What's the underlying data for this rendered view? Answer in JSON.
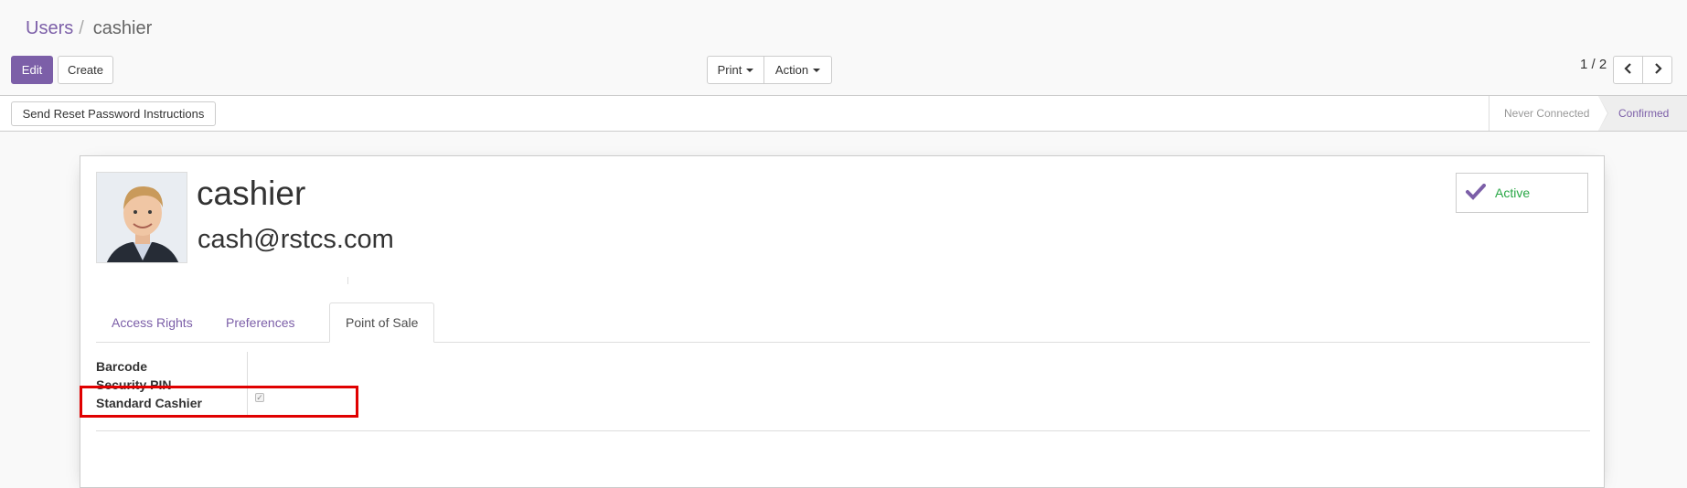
{
  "breadcrumb": {
    "parent": "Users",
    "separator": "/",
    "current": "cashier"
  },
  "buttons": {
    "edit": "Edit",
    "create": "Create",
    "print": "Print",
    "action": "Action"
  },
  "pager": {
    "value": "1 / 2"
  },
  "statusbar": {
    "reset_password": "Send Reset Password Instructions",
    "stages": [
      "Never Connected",
      "Confirmed"
    ],
    "current_stage": "Confirmed"
  },
  "user": {
    "name": "cashier",
    "login": "cash@rstcs.com",
    "active_label": "Active"
  },
  "tabs": [
    "Access Rights",
    "Preferences",
    "Point of Sale"
  ],
  "active_tab": "Point of Sale",
  "pos_fields": {
    "barcode_label": "Barcode",
    "pin_label": "Security PIN",
    "standard_cashier_label": "Standard Cashier",
    "standard_cashier_checked": true
  },
  "colors": {
    "brand": "#7c5fa8",
    "active": "#28a745",
    "highlight": "#e00000"
  }
}
